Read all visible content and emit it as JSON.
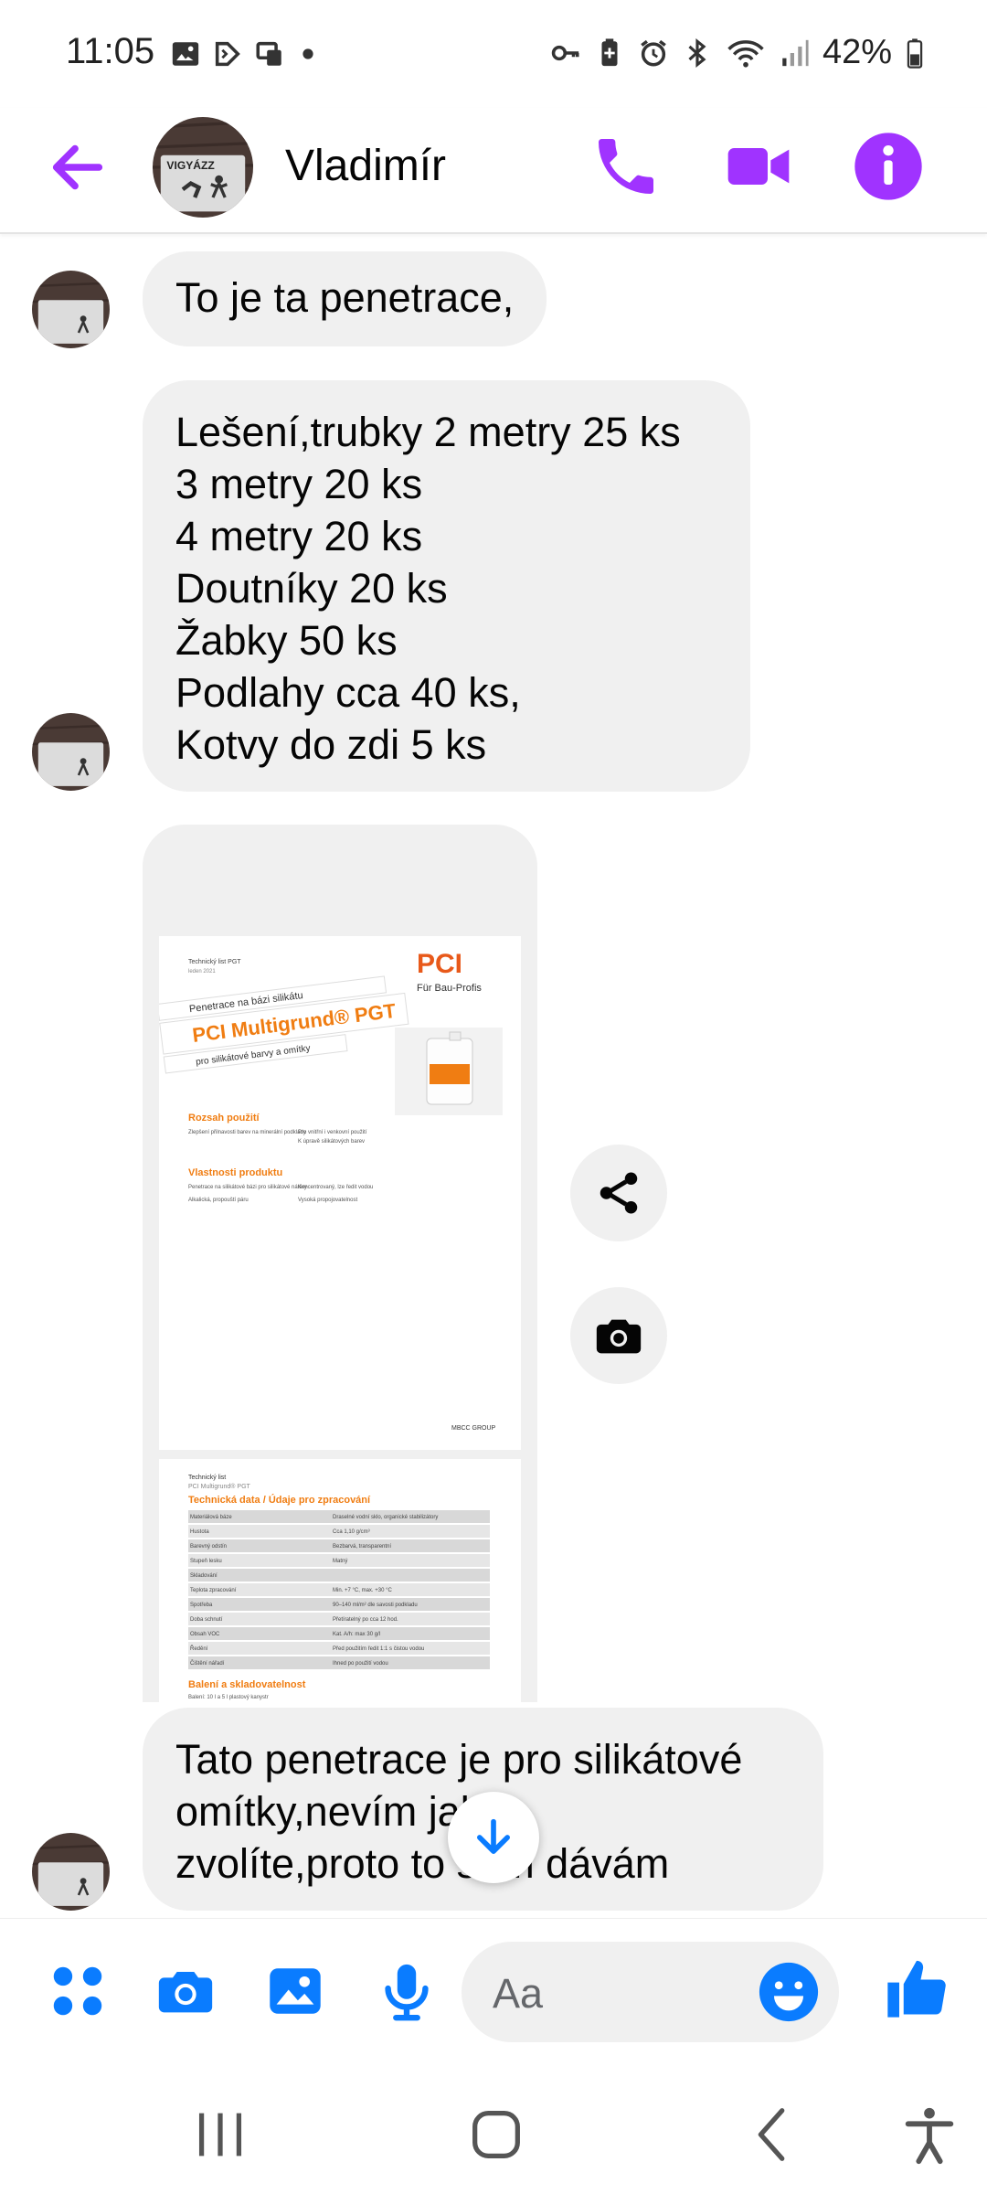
{
  "status_bar": {
    "time": "11:05",
    "battery": "42%",
    "left_icons": [
      "image-icon",
      "sim-icon",
      "screen-icon",
      "dot-icon"
    ],
    "right_icons": [
      "key-icon",
      "battery-saver-icon",
      "alarm-icon",
      "bluetooth-icon",
      "wifi-icon",
      "signal-icon",
      "battery-icon"
    ]
  },
  "header": {
    "contact_name": "Vladimír",
    "avatar_text": "VIGYÁZZ",
    "accent_color": "#a033ff"
  },
  "messages": [
    {
      "text": "To je ta penetrace,"
    },
    {
      "text": "Lešení,trubky 2 metry 25 ks\n3 metry 20 ks\n4 metry 20 ks\nDoutníky 20 ks\nŽabky 50 ks\nPodlahy cca 40 ks,\nKotvy do zdi 5 ks"
    },
    {
      "text": "Tato penetrace je pro silikátové\nomítky,nevím jakou\nzvolíte,proto to sem dávám"
    }
  ],
  "attachment": {
    "page1": {
      "header_small": "Technický list PGT",
      "header_date": "leden 2021",
      "banner_top": "Penetrace na bázi silikátu",
      "banner_main": "PCI Multigrund® PGT",
      "banner_sub": "pro silikátové barvy a omítky",
      "brand": "PCI",
      "brand_tagline": "Für Bau-Profis",
      "section1": "Rozsah použití",
      "section1_items": [
        "Zlepšení přilnavosti barev na minerální podklady",
        "Pro vnitřní i venkovní použití",
        "K úpravě silikátových barev"
      ],
      "section2": "Vlastnosti produktu",
      "section2_items": [
        "Penetrace na silikátové bázi pro silikátové nátěry",
        "Koncentrovaný, lze ředit vodou",
        "Alkalická, propouští páru",
        "Vysoká propojovatelnost"
      ],
      "footer": "MBCC GROUP"
    },
    "page2": {
      "header_small": "Technický list",
      "header_sub": "PCI Multigrund® PGT",
      "section": "Technická data / Údaje pro zpracování",
      "rows": [
        [
          "Materiálová báze",
          "Draselné vodní sklo, organické stabilizátory"
        ],
        [
          "Hustota",
          "Cca 1,10 g/cm³"
        ],
        [
          "Barevný odstín",
          "Bezbarvá, transparentní"
        ],
        [
          "Stupeň lesku",
          "Matný"
        ],
        [
          "Skladování",
          ""
        ],
        [
          "Teplota zpracování",
          "Min. +7 °C, max. +30 °C"
        ],
        [
          "Spotřeba",
          "90–140 ml/m² dle savosti podkladu"
        ],
        [
          "Doba schnutí",
          "Přetíratelný po cca 12 hod."
        ],
        [
          "Obsah VOC",
          "Kat. A/h: max 30 g/l"
        ],
        [
          "Ředění",
          "Před použitím ředit 1:1 s čistou vodou"
        ],
        [
          "Čištění nářadí",
          "Ihned po použití vodou"
        ]
      ],
      "section_bottom": "Balení a skladovatelnost",
      "bottom_item": "Balení: 10 l a 5 l plastový kanystr"
    }
  },
  "composer": {
    "placeholder": "Aa",
    "icon_color": "#0a7cff"
  },
  "nav_bar": [
    "recent-apps-icon",
    "home-icon",
    "back-icon",
    "accessibility-icon"
  ]
}
